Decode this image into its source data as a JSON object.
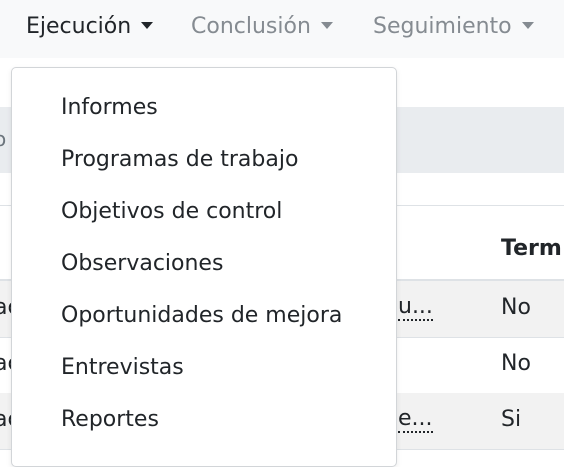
{
  "navbar": {
    "items": [
      {
        "label": "Ejecución",
        "active": true
      },
      {
        "label": "Conclusión",
        "active": false
      },
      {
        "label": "Seguimiento",
        "active": false
      }
    ]
  },
  "dropdown": {
    "items": [
      {
        "label": "Informes"
      },
      {
        "label": "Programas de trabajo"
      },
      {
        "label": "Objetivos de control"
      },
      {
        "label": "Observaciones"
      },
      {
        "label": "Oportunidades de mejora"
      },
      {
        "label": "Entrevistas"
      },
      {
        "label": "Reportes"
      }
    ]
  },
  "background": {
    "breadcrumb_fragment": "o",
    "table": {
      "term_header": "Term",
      "rows": [
        {
          "left": "ac",
          "mid": "u...",
          "term": "No"
        },
        {
          "left": "ac",
          "mid": "",
          "term": "No"
        },
        {
          "left": "ac",
          "mid": "e...",
          "term": "Si"
        }
      ]
    }
  }
}
